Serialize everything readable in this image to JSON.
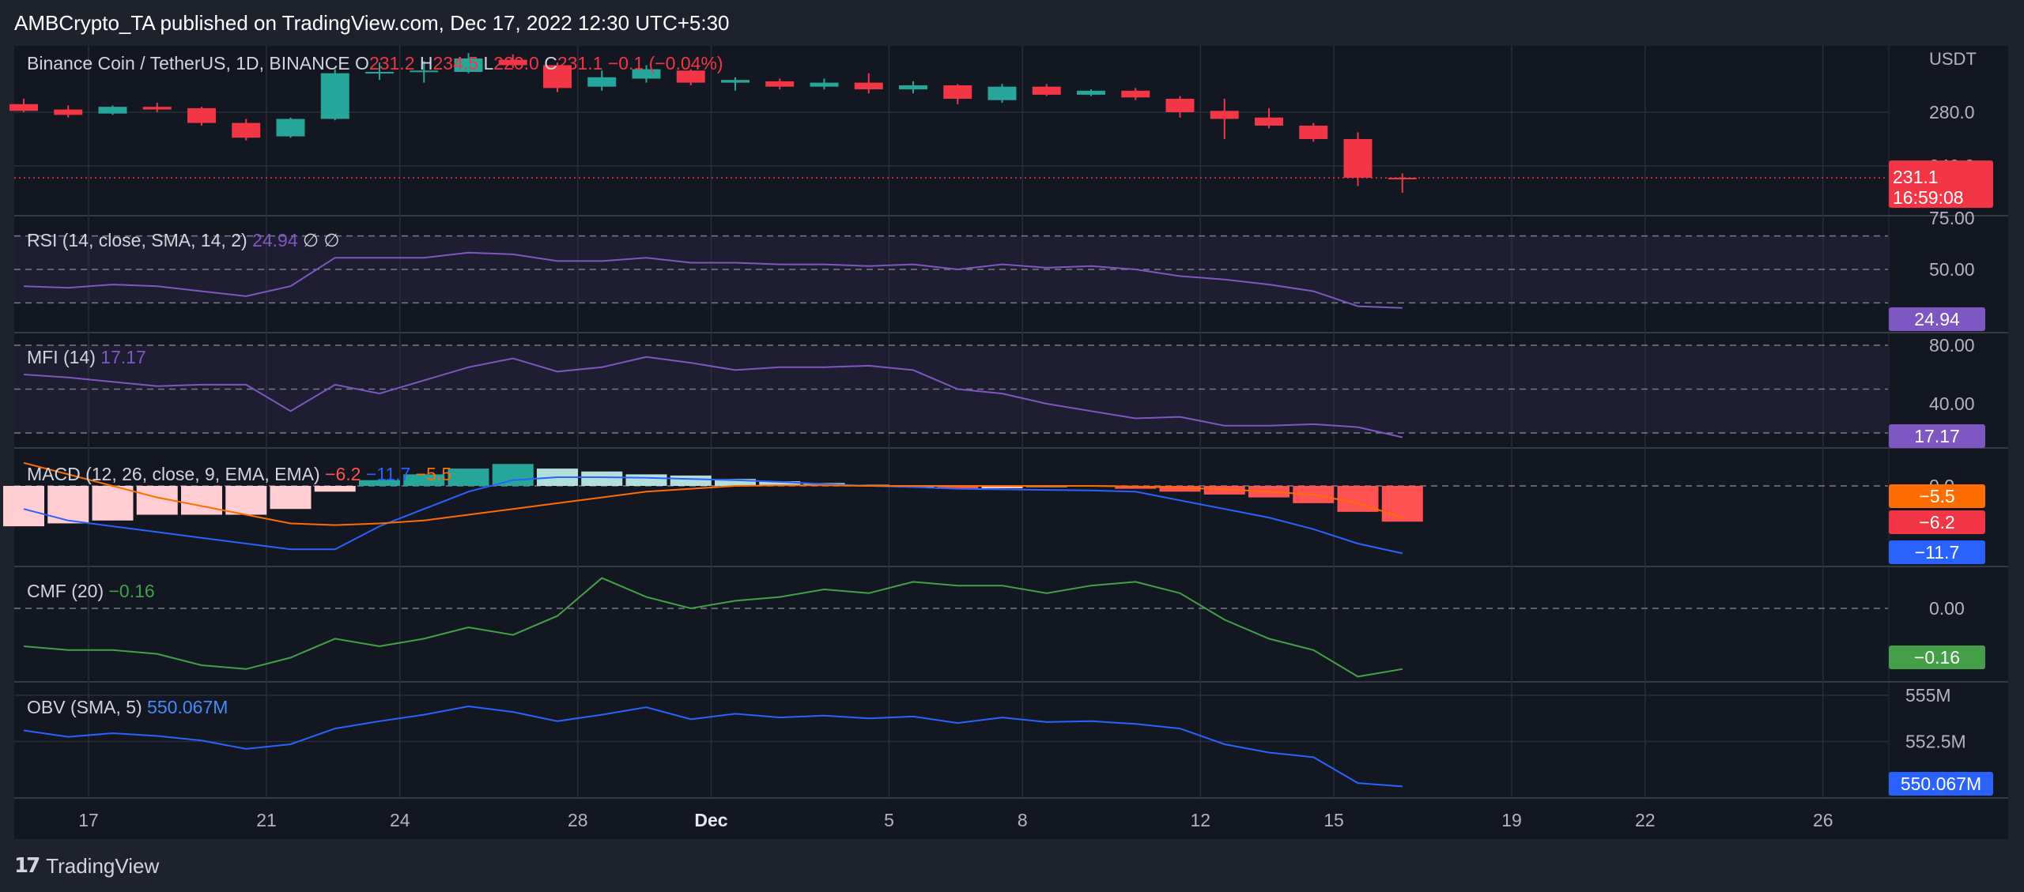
{
  "publisher": "AMBCrypto_TA published on TradingView.com, Dec 17, 2022 12:30 UTC+5:30",
  "footer": {
    "logo_mark": "17",
    "brand": "TradingView"
  },
  "colors": {
    "up": "#26a69a",
    "down": "#f23645",
    "rsi": "#7e57c2",
    "macd": "#2962ff",
    "signal": "#ff6d00",
    "cmf": "#43a047",
    "obv": "#2962ff",
    "bg": "#131722"
  },
  "chart_data": [
    {
      "type": "candlestick",
      "symbol_label": "Binance Coin / TetherUS, 1D, BINANCE",
      "ohlc_label": {
        "o_key": "O",
        "o": "231.2",
        "h_key": "H",
        "h": "234.5",
        "l_key": "L",
        "l": "220.0",
        "c_key": "C",
        "c": "231.1",
        "chg": "−0.1 (−0.04%)"
      },
      "unit": "USDT",
      "y_ticks": [
        "280.0",
        "240.0"
      ],
      "last_price": "231.1",
      "countdown": "16:59:08",
      "x_ticks": [
        {
          "label": "17",
          "day": 1
        },
        {
          "label": "21",
          "day": 5
        },
        {
          "label": "24",
          "day": 8
        },
        {
          "label": "28",
          "day": 12
        },
        {
          "label": "Dec",
          "day": 15
        },
        {
          "label": "5",
          "day": 19
        },
        {
          "label": "8",
          "day": 22
        },
        {
          "label": "12",
          "day": 26
        },
        {
          "label": "15",
          "day": 29
        },
        {
          "label": "19",
          "day": 33
        },
        {
          "label": "22",
          "day": 36
        },
        {
          "label": "26",
          "day": 40
        }
      ],
      "candles": [
        {
          "date": "Nov 16",
          "o": 286,
          "h": 290,
          "l": 280,
          "c": 281
        },
        {
          "date": "Nov 17",
          "o": 282,
          "h": 285,
          "l": 276,
          "c": 278
        },
        {
          "date": "Nov 18",
          "o": 279,
          "h": 285,
          "l": 278,
          "c": 284
        },
        {
          "date": "Nov 19",
          "o": 284,
          "h": 287,
          "l": 280,
          "c": 282
        },
        {
          "date": "Nov 20",
          "o": 283,
          "h": 284,
          "l": 270,
          "c": 272
        },
        {
          "date": "Nov 21",
          "o": 272,
          "h": 275,
          "l": 259,
          "c": 261
        },
        {
          "date": "Nov 22",
          "o": 262,
          "h": 276,
          "l": 261,
          "c": 275
        },
        {
          "date": "Nov 23",
          "o": 275,
          "h": 312,
          "l": 274,
          "c": 309
        },
        {
          "date": "Nov 24",
          "o": 309,
          "h": 317,
          "l": 304,
          "c": 310
        },
        {
          "date": "Nov 25",
          "o": 310,
          "h": 318,
          "l": 302,
          "c": 311
        },
        {
          "date": "Nov 26",
          "o": 310,
          "h": 324,
          "l": 309,
          "c": 320
        },
        {
          "date": "Nov 27",
          "o": 319,
          "h": 323,
          "l": 313,
          "c": 315
        },
        {
          "date": "Nov 28",
          "o": 315,
          "h": 317,
          "l": 295,
          "c": 298
        },
        {
          "date": "Nov 29",
          "o": 299,
          "h": 311,
          "l": 296,
          "c": 306
        },
        {
          "date": "Nov 30",
          "o": 305,
          "h": 315,
          "l": 302,
          "c": 312
        },
        {
          "date": "Dec 1",
          "o": 311,
          "h": 312,
          "l": 300,
          "c": 302
        },
        {
          "date": "Dec 2",
          "o": 302,
          "h": 306,
          "l": 296,
          "c": 304
        },
        {
          "date": "Dec 3",
          "o": 303,
          "h": 305,
          "l": 297,
          "c": 299
        },
        {
          "date": "Dec 4",
          "o": 299,
          "h": 305,
          "l": 297,
          "c": 302
        },
        {
          "date": "Dec 5",
          "o": 302,
          "h": 309,
          "l": 294,
          "c": 297
        },
        {
          "date": "Dec 6",
          "o": 297,
          "h": 303,
          "l": 294,
          "c": 300
        },
        {
          "date": "Dec 7",
          "o": 300,
          "h": 301,
          "l": 286,
          "c": 290
        },
        {
          "date": "Dec 8",
          "o": 289,
          "h": 301,
          "l": 287,
          "c": 299
        },
        {
          "date": "Dec 9",
          "o": 299,
          "h": 301,
          "l": 292,
          "c": 293
        },
        {
          "date": "Dec 10",
          "o": 293,
          "h": 297,
          "l": 292,
          "c": 296
        },
        {
          "date": "Dec 11",
          "o": 296,
          "h": 298,
          "l": 289,
          "c": 291
        },
        {
          "date": "Dec 12",
          "o": 290,
          "h": 292,
          "l": 276,
          "c": 280
        },
        {
          "date": "Dec 13",
          "o": 281,
          "h": 290,
          "l": 260,
          "c": 275
        },
        {
          "date": "Dec 14",
          "o": 276,
          "h": 283,
          "l": 268,
          "c": 270
        },
        {
          "date": "Dec 15",
          "o": 270,
          "h": 272,
          "l": 258,
          "c": 260
        },
        {
          "date": "Dec 16",
          "o": 260,
          "h": 265,
          "l": 225,
          "c": 231.2
        },
        {
          "date": "Dec 17",
          "o": 231.2,
          "h": 234.5,
          "l": 220.0,
          "c": 231.1
        }
      ]
    },
    {
      "type": "line",
      "name": "RSI",
      "label": "RSI (14, close, SMA, 14, 2)",
      "value_label": "24.94",
      "extra_symbols": [
        "∅",
        "∅"
      ],
      "y_ticks": [
        "75.00",
        "50.00"
      ],
      "bands": [
        70,
        50,
        30
      ],
      "last_value": "24.94",
      "values": [
        40,
        39,
        41,
        40,
        37,
        34,
        40,
        57,
        57,
        57,
        60,
        59,
        55,
        55,
        57,
        54,
        54,
        53,
        53,
        52,
        53,
        50,
        53,
        51,
        52,
        50,
        46,
        44,
        41,
        37,
        28,
        27
      ]
    },
    {
      "type": "line",
      "name": "MFI",
      "label": "MFI (14)",
      "value_label": "17.17",
      "y_ticks": [
        "80.00",
        "40.00"
      ],
      "bands": [
        80,
        50,
        20
      ],
      "last_value": "17.17",
      "values": [
        60,
        58,
        55,
        52,
        53,
        53,
        35,
        53,
        47,
        56,
        65,
        71,
        62,
        65,
        72,
        68,
        63,
        65,
        65,
        66,
        63,
        50,
        47,
        40,
        35,
        30,
        31,
        25,
        25,
        26,
        24,
        17
      ]
    },
    {
      "type": "bar+line",
      "name": "MACD",
      "label": "MACD (12, 26, close, 9, EMA, EMA)",
      "value_labels": [
        "−6.2",
        "−11.7",
        "−5.5"
      ],
      "y_ticks": [
        "0.0"
      ],
      "last_values": {
        "histogram": "−6.2",
        "macd": "−11.7",
        "signal": "−5.5"
      },
      "histogram": [
        -7,
        -6.5,
        -6,
        -5,
        -5,
        -5,
        -4,
        -1,
        1,
        2,
        3,
        3.8,
        3.0,
        2.5,
        2.0,
        1.8,
        1.2,
        0.8,
        0.5,
        0.2,
        0,
        -0.5,
        -0.4,
        -0.2,
        0.1,
        -0.5,
        -1.0,
        -1.5,
        -2.0,
        -3.0,
        -4.5,
        -6.2
      ],
      "macd": [
        -4,
        -6,
        -7,
        -8,
        -9,
        -10,
        -11,
        -11,
        -7,
        -4,
        -1,
        1,
        1.5,
        1.5,
        1.4,
        1.2,
        1,
        0.7,
        0.3,
        0,
        -0.2,
        -0.5,
        -0.6,
        -0.7,
        -0.8,
        -1.0,
        -2.5,
        -4,
        -5.5,
        -7.5,
        -10,
        -11.7
      ],
      "signal": [
        4,
        2,
        0,
        -2,
        -3.5,
        -5,
        -6.5,
        -6.8,
        -6.5,
        -6,
        -5,
        -4,
        -3,
        -2,
        -1,
        -0.5,
        0,
        0.1,
        0.1,
        0,
        0,
        0,
        0,
        0,
        0,
        -0.1,
        -0.3,
        -0.6,
        -1,
        -1.5,
        -3,
        -5.5
      ]
    },
    {
      "type": "line",
      "name": "CMF",
      "label": "CMF (20)",
      "value_label": "−0.16",
      "y_ticks": [
        "0.00"
      ],
      "last_value": "−0.16",
      "values": [
        -0.1,
        -0.11,
        -0.11,
        -0.12,
        -0.15,
        -0.16,
        -0.13,
        -0.08,
        -0.1,
        -0.08,
        -0.05,
        -0.07,
        -0.02,
        0.08,
        0.03,
        0.0,
        0.02,
        0.03,
        0.05,
        0.04,
        0.07,
        0.06,
        0.06,
        0.04,
        0.06,
        0.07,
        0.04,
        -0.03,
        -0.08,
        -0.11,
        -0.18,
        -0.16
      ]
    },
    {
      "type": "line",
      "name": "OBV",
      "label": "OBV (SMA, 5)",
      "value_label": "550.067M",
      "y_ticks": [
        "555M",
        "552.5M"
      ],
      "last_value": "550.067M",
      "values": [
        553.1,
        552.75,
        552.95,
        552.8,
        552.55,
        552.1,
        552.35,
        553.2,
        553.6,
        553.95,
        554.4,
        554.1,
        553.6,
        553.95,
        554.35,
        553.7,
        554.0,
        553.8,
        553.9,
        553.75,
        553.85,
        553.5,
        553.8,
        553.55,
        553.6,
        553.45,
        553.2,
        552.35,
        551.9,
        551.65,
        550.25,
        550.067
      ]
    }
  ]
}
